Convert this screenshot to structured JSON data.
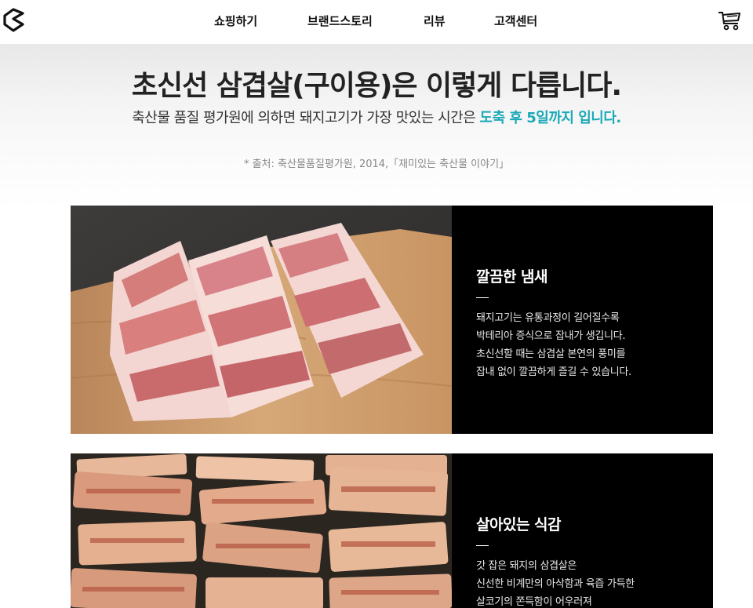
{
  "header": {
    "logo_icon": "brand-logo-icon",
    "nav": [
      {
        "label": "쇼핑하기"
      },
      {
        "label": "브랜드스토리"
      },
      {
        "label": "리뷰"
      },
      {
        "label": "고객센터"
      }
    ],
    "cart_icon": "cart-icon"
  },
  "intro": {
    "title": "초신선 삼겹살(구이용)은 이렇게 다릅니다.",
    "subtitle_prefix": "축산물 품질 평가원에 의하면 돼지고기가 가장 맛있는 시간은 ",
    "subtitle_highlight": "도축 후 5일까지 입니다.",
    "highlight_color": "#1aa9b8",
    "source": "* 출처: 축산물품질평가원, 2014,「재미있는 축산물 이야기」"
  },
  "features": [
    {
      "title": "깔끔한 냄새",
      "lines": [
        "돼지고기는 유통과정이 길어질수록",
        "박테리아 증식으로 잡내가 생깁니다.",
        "초신선할 때는 삼겹살 본연의 풍미를",
        "잡내 없이 깔끔하게 즐길 수 있습니다."
      ]
    },
    {
      "title": "살아있는 식감",
      "lines": [
        "갓 잡은 돼지의 삼겹살은",
        "신선한 비계만의 아삭함과 육즙 가득한",
        "살코기의 쫀득함이 어우러져"
      ]
    }
  ]
}
